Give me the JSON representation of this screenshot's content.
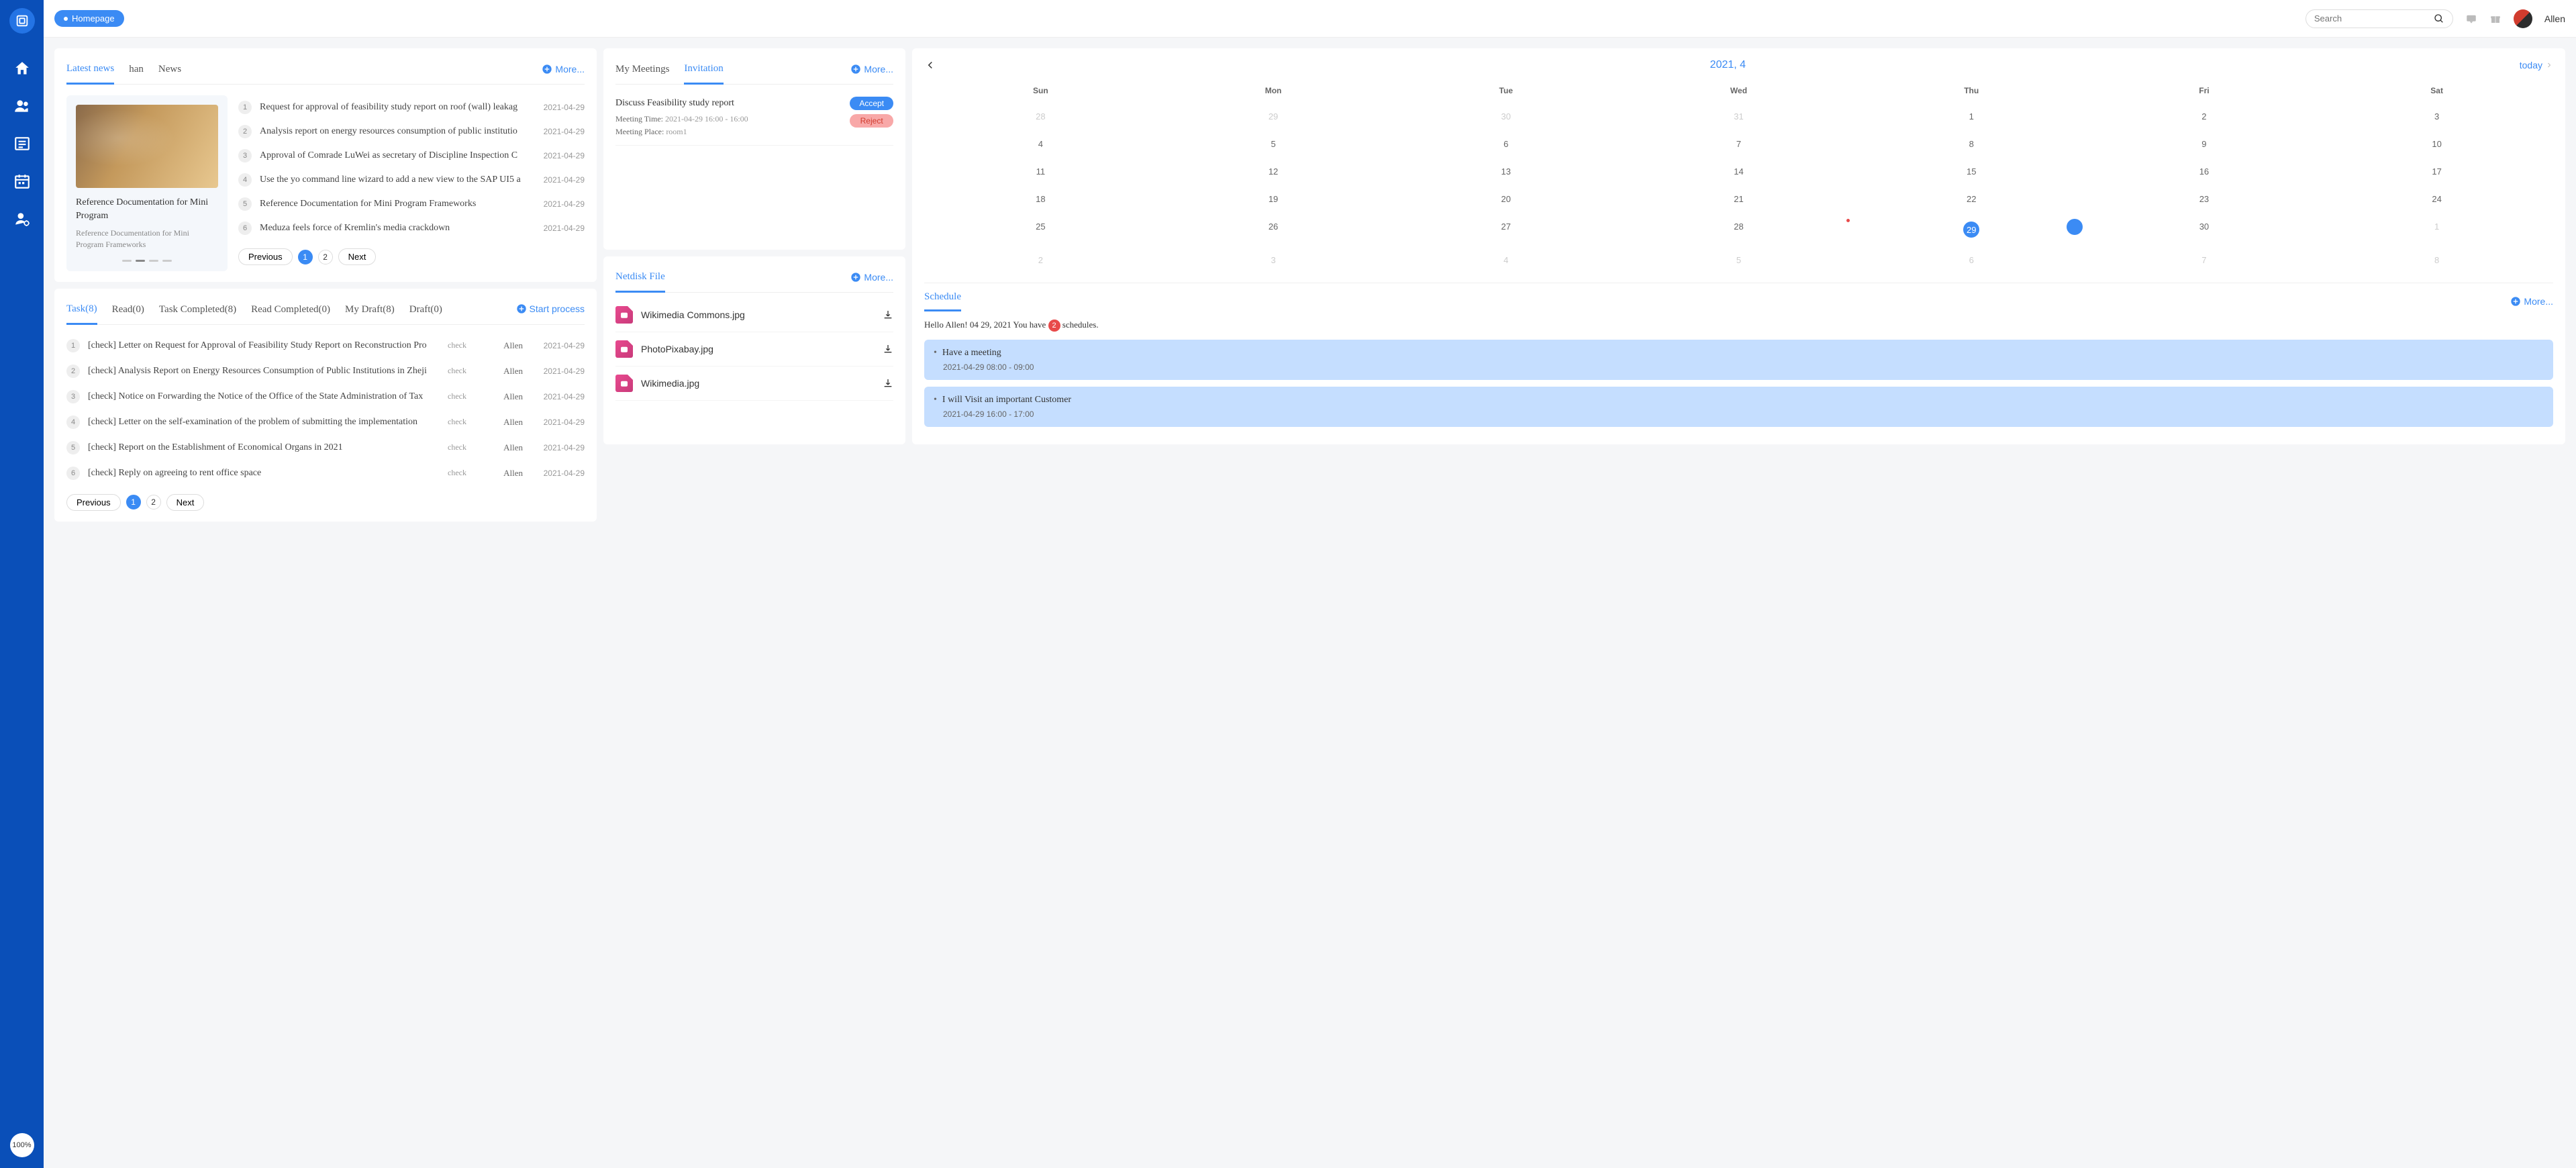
{
  "topbar": {
    "homepage": "Homepage",
    "search_placeholder": "Search",
    "username": "Allen",
    "zoom": "100%"
  },
  "news": {
    "tabs": [
      "Latest news",
      "han",
      "News"
    ],
    "active_tab": 0,
    "more": "More...",
    "carousel": {
      "title": "Reference Documentation for Mini Program",
      "subtitle": "Reference Documentation for Mini Program Frameworks"
    },
    "items": [
      {
        "n": "1",
        "title": "Request for approval of feasibility study report on roof (wall) leakag",
        "date": "2021-04-29"
      },
      {
        "n": "2",
        "title": "Analysis report on energy resources consumption of public institutio",
        "date": "2021-04-29"
      },
      {
        "n": "3",
        "title": "Approval of Comrade LuWei as secretary of Discipline Inspection C",
        "date": "2021-04-29"
      },
      {
        "n": "4",
        "title": "Use the yo command line wizard to add a new view to the SAP UI5 a",
        "date": "2021-04-29"
      },
      {
        "n": "5",
        "title": "Reference Documentation for Mini Program Frameworks",
        "date": "2021-04-29"
      },
      {
        "n": "6",
        "title": "Meduza feels force of Kremlin's media crackdown",
        "date": "2021-04-29"
      }
    ],
    "pager": {
      "prev": "Previous",
      "next": "Next",
      "pages": [
        "1",
        "2"
      ],
      "active": 0
    }
  },
  "meetings": {
    "tabs": [
      "My Meetings",
      "Invitation"
    ],
    "active_tab": 1,
    "more": "More...",
    "items": [
      {
        "title": "Discuss Feasibility study report",
        "time_label": "Meeting Time:",
        "time_value": "2021-04-29 16:00 - 16:00",
        "place_label": "Meeting Place:",
        "place_value": "room1",
        "accept": "Accept",
        "reject": "Reject"
      }
    ]
  },
  "tasks": {
    "tabs": [
      "Task(8)",
      "Read(0)",
      "Task Completed(8)",
      "Read Completed(0)",
      "My Draft(8)",
      "Draft(0)"
    ],
    "active_tab": 0,
    "start": "Start process",
    "items": [
      {
        "n": "1",
        "title": "[check] Letter on Request for Approval of Feasibility Study Report on Reconstruction Pro",
        "type": "check",
        "user": "Allen",
        "date": "2021-04-29"
      },
      {
        "n": "2",
        "title": "[check] Analysis Report on Energy Resources Consumption of Public Institutions in Zheji",
        "type": "check",
        "user": "Allen",
        "date": "2021-04-29"
      },
      {
        "n": "3",
        "title": "[check] Notice on Forwarding the Notice of the Office of the State Administration of Tax",
        "type": "check",
        "user": "Allen",
        "date": "2021-04-29"
      },
      {
        "n": "4",
        "title": "[check] Letter on the self-examination of the problem of submitting the implementation",
        "type": "check",
        "user": "Allen",
        "date": "2021-04-29"
      },
      {
        "n": "5",
        "title": "[check] Report on the Establishment of Economical Organs in 2021",
        "type": "check",
        "user": "Allen",
        "date": "2021-04-29"
      },
      {
        "n": "6",
        "title": "[check] Reply on agreeing to rent office space",
        "type": "check",
        "user": "Allen",
        "date": "2021-04-29"
      }
    ],
    "pager": {
      "prev": "Previous",
      "next": "Next",
      "pages": [
        "1",
        "2"
      ],
      "active": 0
    }
  },
  "netdisk": {
    "tab": "Netdisk File",
    "more": "More...",
    "files": [
      {
        "name": "Wikimedia Commons.jpg"
      },
      {
        "name": "PhotoPixabay.jpg"
      },
      {
        "name": "Wikimedia.jpg"
      }
    ]
  },
  "calendar": {
    "title": "2021, 4",
    "today": "today",
    "dow": [
      "Sun",
      "Mon",
      "Tue",
      "Wed",
      "Thu",
      "Fri",
      "Sat"
    ],
    "weeks": [
      [
        {
          "d": "28",
          "o": true
        },
        {
          "d": "29",
          "o": true
        },
        {
          "d": "30",
          "o": true
        },
        {
          "d": "31",
          "o": true
        },
        {
          "d": "1"
        },
        {
          "d": "2"
        },
        {
          "d": "3"
        }
      ],
      [
        {
          "d": "4"
        },
        {
          "d": "5"
        },
        {
          "d": "6"
        },
        {
          "d": "7"
        },
        {
          "d": "8"
        },
        {
          "d": "9"
        },
        {
          "d": "10"
        }
      ],
      [
        {
          "d": "11"
        },
        {
          "d": "12"
        },
        {
          "d": "13"
        },
        {
          "d": "14"
        },
        {
          "d": "15"
        },
        {
          "d": "16"
        },
        {
          "d": "17"
        }
      ],
      [
        {
          "d": "18"
        },
        {
          "d": "19"
        },
        {
          "d": "20"
        },
        {
          "d": "21"
        },
        {
          "d": "22"
        },
        {
          "d": "23"
        },
        {
          "d": "24"
        }
      ],
      [
        {
          "d": "25"
        },
        {
          "d": "26"
        },
        {
          "d": "27"
        },
        {
          "d": "28",
          "dot": true
        },
        {
          "d": "29",
          "dot": true,
          "today": true
        },
        {
          "d": "30"
        },
        {
          "d": "1",
          "o": true
        }
      ],
      [
        {
          "d": "2",
          "o": true
        },
        {
          "d": "3",
          "o": true
        },
        {
          "d": "4",
          "o": true
        },
        {
          "d": "5",
          "o": true
        },
        {
          "d": "6",
          "o": true
        },
        {
          "d": "7",
          "o": true
        },
        {
          "d": "8",
          "o": true
        }
      ]
    ]
  },
  "schedule": {
    "title": "Schedule",
    "more": "More...",
    "greeting_pre": "Hello Allen! 04 29, 2021 You have ",
    "count": "2",
    "greeting_post": " schedules.",
    "items": [
      {
        "title": "Have a meeting",
        "time": "2021-04-29 08:00 - 09:00"
      },
      {
        "title": "I will Visit an important Customer",
        "time": "2021-04-29 16:00 - 17:00"
      }
    ]
  }
}
